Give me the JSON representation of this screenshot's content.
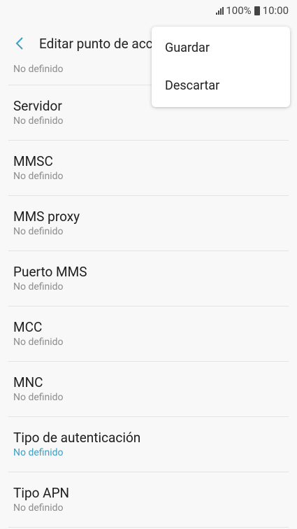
{
  "status_bar": {
    "battery_percent": "100%",
    "time": "10:00"
  },
  "app_bar": {
    "title": "Editar punto de acceso"
  },
  "settings": [
    {
      "label": "",
      "value": "No definido",
      "partial": true
    },
    {
      "label": "Servidor",
      "value": "No definido"
    },
    {
      "label": "MMSC",
      "value": "No definido"
    },
    {
      "label": "MMS proxy",
      "value": "No definido"
    },
    {
      "label": "Puerto MMS",
      "value": "No definido"
    },
    {
      "label": "MCC",
      "value": "No definido"
    },
    {
      "label": "MNC",
      "value": "No definido"
    },
    {
      "label": "Tipo de autenticación",
      "value": "No definido",
      "accent": true
    },
    {
      "label": "Tipo APN",
      "value": "No definido"
    }
  ],
  "menu": {
    "items": [
      "Guardar",
      "Descartar"
    ]
  },
  "colors": {
    "accent": "#3b9ec4",
    "background": "#f8f8f8"
  }
}
